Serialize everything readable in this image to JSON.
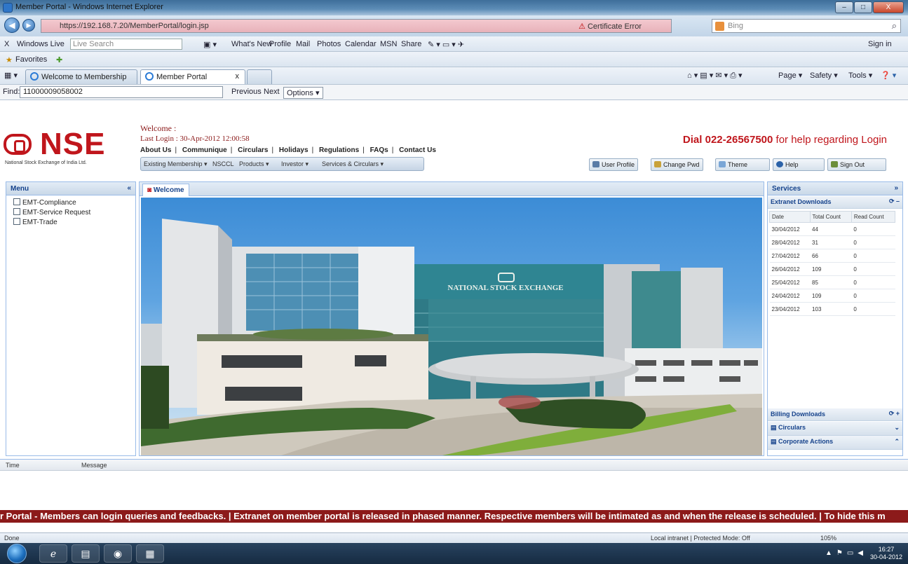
{
  "window": {
    "title": "Member Portal - Windows Internet Explorer",
    "buttons": [
      "–",
      "□",
      "X"
    ]
  },
  "address": {
    "url": "https://192.168.7.20/MemberPortal/login.jsp",
    "cert": "Certificate Error",
    "search_placeholder": "Bing"
  },
  "linksbar": {
    "close": "X",
    "windows_live": "Windows Live",
    "live_search": "Live Search",
    "items": [
      "What's New",
      "Profile",
      "Mail",
      "Photos",
      "Calendar",
      "MSN",
      "Share"
    ],
    "sign_in": "Sign in"
  },
  "favorites": {
    "label": "Favorites"
  },
  "tabs": {
    "tab1": "Welcome to Membership ...",
    "tab2": "Member Portal",
    "close": "x"
  },
  "commandbar": {
    "items": [
      "Page ▾",
      "Safety ▾",
      "Tools ▾"
    ]
  },
  "find": {
    "label": "Find:",
    "value": "11000009058002",
    "previous": "Previous",
    "next": "Next",
    "options": "Options ▾"
  },
  "header": {
    "logo_text": "NSE",
    "logo_sub": "National Stock Exchange of India Ltd.",
    "welcome": "Welcome :",
    "last_login": "Last Login : 30-Apr-2012 12:00:58",
    "links": [
      "About Us",
      "Communique",
      "Circulars",
      "Holidays",
      "Regulations",
      "FAQs",
      "Contact Us"
    ],
    "dial_prefix": "Dial ",
    "dial_number": "022-26567500",
    "dial_suffix": " for help regarding Login",
    "menu": [
      "Existing Membership ▾",
      "NSCCL",
      "Products ▾",
      "Investor ▾",
      "Services & Circulars ▾"
    ],
    "tools": [
      "User Profile",
      "Change Pwd",
      "Theme",
      "Help",
      "Sign Out"
    ]
  },
  "left_panel": {
    "title": "Menu",
    "items": [
      "EMT-Compliance",
      "EMT-Service Request",
      "EMT-Trade"
    ]
  },
  "center": {
    "tab": "Welcome",
    "building_sign": "NATIONAL STOCK EXCHANGE"
  },
  "right_panel": {
    "title": "Services",
    "extranet_title": "Extranet Downloads",
    "columns": [
      "Date",
      "Total Count",
      "Read Count"
    ],
    "rows": [
      [
        "30/04/2012",
        "44",
        "0"
      ],
      [
        "28/04/2012",
        "31",
        "0"
      ],
      [
        "27/04/2012",
        "66",
        "0"
      ],
      [
        "26/04/2012",
        "109",
        "0"
      ],
      [
        "25/04/2012",
        "85",
        "0"
      ],
      [
        "24/04/2012",
        "109",
        "0"
      ],
      [
        "23/04/2012",
        "103",
        "0"
      ]
    ],
    "billing": "Billing Downloads",
    "circulars": "Circulars",
    "corporate": "Corporate Actions"
  },
  "messages": {
    "col_time": "Time",
    "col_message": "Message"
  },
  "ticker": "r Portal - Members can login queries and feedbacks. | Extranet on member portal is released in phased manner. Respective members will be intimated as and when the release is scheduled. | To hide this m",
  "status": {
    "left": "Done",
    "zone": "Local intranet | Protected Mode: Off",
    "zoom": "105%"
  },
  "taskbar": {
    "time": "16:27",
    "date": "30-04-2012"
  }
}
